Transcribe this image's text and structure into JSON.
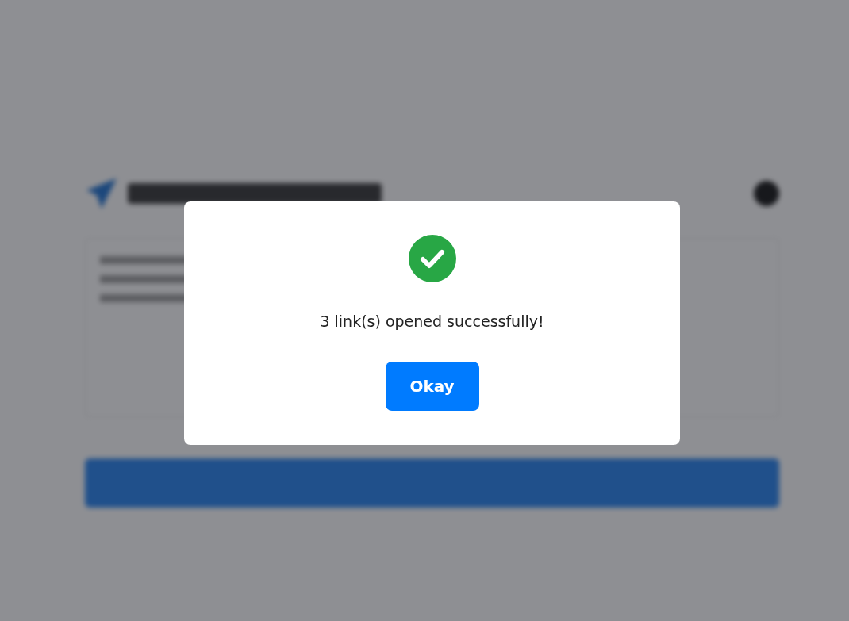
{
  "dialog": {
    "message": "3 link(s) opened successfully!",
    "button": "Okay"
  }
}
